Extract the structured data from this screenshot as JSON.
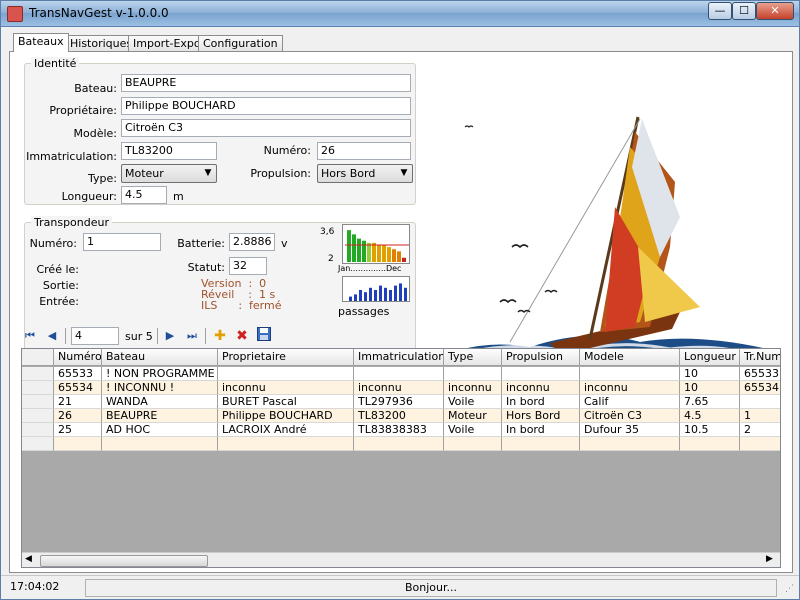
{
  "window": {
    "title": "TransNavGest  v-1.0.0.0",
    "minimize": "—",
    "maximize": "☐",
    "close": "✕"
  },
  "tabs": [
    "Bateaux",
    "Historiques",
    "Import-Export",
    "Configuration"
  ],
  "identite": {
    "legend": "Identité",
    "bateau_label": "Bateau:",
    "bateau": "BEAUPRE",
    "proprietaire_label": "Propriétaire:",
    "proprietaire": "Philippe BOUCHARD",
    "modele_label": "Modèle:",
    "modele": "Citroën C3",
    "immatriculation_label": "Immatriculation:",
    "immatriculation": "TL83200",
    "numero_label": "Numéro:",
    "numero": "26",
    "type_label": "Type:",
    "type": "Moteur",
    "propulsion_label": "Propulsion:",
    "propulsion": "Hors Bord",
    "longueur_label": "Longueur:",
    "longueur": "4.5",
    "longueur_unit": "m"
  },
  "transpondeur": {
    "legend": "Transpondeur",
    "numero_label": "Numéro:",
    "numero": "1",
    "batterie_label": "Batterie:",
    "batterie": "2.8886",
    "batterie_unit": "v",
    "cree_label": "Créé le:",
    "sortie_label": "Sortie:",
    "entree_label": "Entrée:",
    "statut_label": "Statut:",
    "statut": "32",
    "version": "Version  :  0",
    "reveil": "Réveil    :  1 s",
    "ils": "ILS      :  fermé"
  },
  "chart_data": [
    {
      "type": "bar",
      "ymax_label": "3,6",
      "ymin_label": "2",
      "x_start_label": "Jan",
      "x_mid_label": "..............",
      "x_end_label": "Dec",
      "values": [
        3.5,
        3.3,
        3.1,
        3.0,
        2.9,
        2.9,
        2.8,
        2.8,
        2.7,
        2.6,
        2.5,
        2.2
      ],
      "colors": [
        "#22aa22",
        "#22aa22",
        "#22aa22",
        "#22aa22",
        "#99cc33",
        "#e0a000",
        "#e0a000",
        "#e0a000",
        "#e0a000",
        "#e08000",
        "#e08000",
        "#cc2222"
      ],
      "threshold": 2.8,
      "ylim": [
        2,
        3.6
      ]
    },
    {
      "type": "bar",
      "label": "passages",
      "values": [
        2,
        3,
        5,
        4,
        6,
        5,
        7,
        6,
        5,
        7,
        8,
        6
      ],
      "ylim": [
        0,
        10
      ]
    }
  ],
  "navigator": {
    "position": "4",
    "of_label": "sur 5"
  },
  "grid": {
    "columns": [
      "Numéro",
      "Bateau",
      "Proprietaire",
      "Immatriculation",
      "Type",
      "Propulsion",
      "Modele",
      "Longueur",
      "Tr.Num."
    ],
    "rows": [
      [
        "65533",
        "! NON PROGRAMME !",
        "",
        "",
        "",
        "",
        "",
        "10",
        "65533"
      ],
      [
        "65534",
        "! INCONNU !",
        "inconnu",
        "inconnu",
        "inconnu",
        "inconnu",
        "inconnu",
        "10",
        "65534"
      ],
      [
        "21",
        "WANDA",
        "BURET Pascal",
        "TL297936",
        "Voile",
        "In bord",
        "Calif",
        "7.65",
        ""
      ],
      [
        "26",
        "BEAUPRE",
        "Philippe BOUCHARD",
        "TL83200",
        "Moteur",
        "Hors Bord",
        "Citroën C3",
        "4.5",
        "1"
      ],
      [
        "25",
        "AD HOC",
        "LACROIX André",
        "TL83838383",
        "Voile",
        "In bord",
        "Dufour 35",
        "10.5",
        "2"
      ]
    ]
  },
  "status": {
    "time": "17:04:02",
    "message": "Bonjour..."
  }
}
